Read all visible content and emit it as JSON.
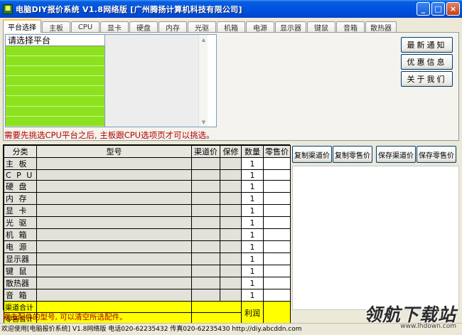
{
  "window": {
    "title": "电脑DIY报价系统 V1.8网络版 [广州腾扬计算机科技有限公司]",
    "minimize": "_",
    "maximize": "□",
    "close": "×"
  },
  "tabs": [
    "平台选择",
    "主板",
    "CPU",
    "显卡",
    "硬盘",
    "内存",
    "光驱",
    "机箱",
    "电源",
    "显示器",
    "键鼠",
    "音箱",
    "散热器"
  ],
  "platform_list": {
    "header": "请选择平台",
    "green_rows": 8
  },
  "side_buttons": {
    "news": "最新通知",
    "deals": "优惠信息",
    "about": "关于我们"
  },
  "hint": "需要先挑选CPU平台之后, 主板跟CPU选项页才可以挑选。",
  "table": {
    "headers": {
      "category": "分类",
      "model": "型号",
      "channel_price": "渠道价",
      "warranty": "保修",
      "qty": "数量",
      "retail_price": "零售价"
    },
    "rows": [
      {
        "category": "主 板",
        "qty": "1"
      },
      {
        "category": "C P U",
        "qty": "1"
      },
      {
        "category": "硬 盘",
        "qty": "1"
      },
      {
        "category": "内 存",
        "qty": "1"
      },
      {
        "category": "显 卡",
        "qty": "1"
      },
      {
        "category": "光 驱",
        "qty": "1"
      },
      {
        "category": "机 箱",
        "qty": "1"
      },
      {
        "category": "电 源",
        "qty": "1"
      },
      {
        "category": "显示器",
        "qty": "1"
      },
      {
        "category": "键 鼠",
        "qty": "1"
      },
      {
        "category": "散热器",
        "qty": "1"
      },
      {
        "category": "音 箱",
        "qty": "1"
      }
    ],
    "channel_total": "渠道合计",
    "retail_total": "零售合计",
    "profit": "利润"
  },
  "action_buttons": {
    "copy_channel": "复制渠道价",
    "copy_retail": "复制零售价",
    "save_channel": "保存渠道价",
    "save_retail": "保存零售价"
  },
  "footer_hint": "双击配件的型号, 可以清空所选配件。",
  "status_bar": "欢迎使用[电脑报价系统] V1.8网络版 电话020-62235432 传真020-62235430 http://diy.abcddn.com",
  "watermark": {
    "text": "领航下载站",
    "url": "www.lhdown.com"
  }
}
